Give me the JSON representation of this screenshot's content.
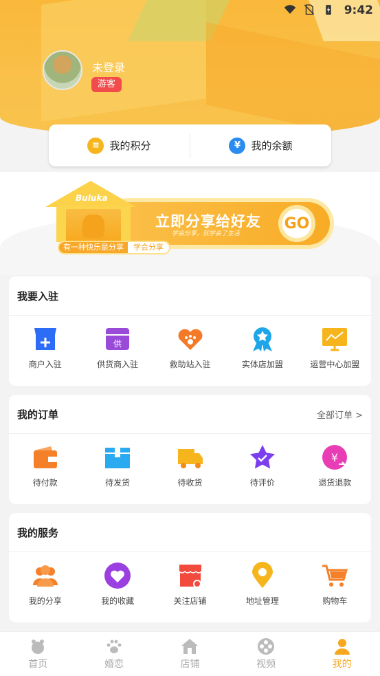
{
  "status_bar": {
    "time": "9:42"
  },
  "profile": {
    "username": "未登录",
    "role_badge": "游客"
  },
  "balance": {
    "points_label": "我的积分",
    "balance_label": "我的余额",
    "points_icon": "coins-icon",
    "balance_icon": "yen-icon"
  },
  "banner": {
    "brand": "Buluka",
    "title": "立即分享给好友",
    "subtitle": "学会分享，就学会了生活",
    "go_label": "GO",
    "tag_left": "有一种快乐是分享",
    "tag_right": "学会分享"
  },
  "settle_in": {
    "title": "我要入驻",
    "items": [
      {
        "label": "商户入驻",
        "icon": "store-add-icon",
        "color": "#2c6cf6"
      },
      {
        "label": "供货商入驻",
        "icon": "supplier-icon",
        "color": "#9a4ad9"
      },
      {
        "label": "救助站入驻",
        "icon": "paw-heart-icon",
        "color": "#f47a28"
      },
      {
        "label": "实体店加盟",
        "icon": "ribbon-star-icon",
        "color": "#1fa6e8"
      },
      {
        "label": "运营中心加盟",
        "icon": "monitor-chart-icon",
        "color": "#f7b51d"
      }
    ]
  },
  "orders": {
    "title": "我的订单",
    "more": "全部订单 >",
    "items": [
      {
        "label": "待付款",
        "icon": "wallet-icon",
        "color": "#f4812a"
      },
      {
        "label": "待发货",
        "icon": "box-icon",
        "color": "#2aaaf0"
      },
      {
        "label": "待收货",
        "icon": "truck-icon",
        "color": "#f7b51d"
      },
      {
        "label": "待评价",
        "icon": "star-check-icon",
        "color": "#7b3ff0"
      },
      {
        "label": "退货退款",
        "icon": "refund-icon",
        "color": "#e93db6"
      }
    ]
  },
  "services": {
    "title": "我的服务",
    "items": [
      {
        "label": "我的分享",
        "icon": "people-icon",
        "color": "#f4812a"
      },
      {
        "label": "我的收藏",
        "icon": "heart-icon",
        "color": "#9a3fe0"
      },
      {
        "label": "关注店铺",
        "icon": "shop-follow-icon",
        "color": "#f24a3d"
      },
      {
        "label": "地址管理",
        "icon": "location-pin-icon",
        "color": "#f7b51d"
      },
      {
        "label": "购物车",
        "icon": "cart-icon",
        "color": "#f4812a"
      }
    ]
  },
  "tabbar": {
    "items": [
      {
        "label": "首页",
        "icon": "home-pet-icon"
      },
      {
        "label": "婚恋",
        "icon": "paw-icon"
      },
      {
        "label": "店铺",
        "icon": "house-icon"
      },
      {
        "label": "视频",
        "icon": "film-reel-icon"
      },
      {
        "label": "我的",
        "icon": "person-icon"
      }
    ],
    "active_index": 4,
    "active_color": "#f7a71d"
  }
}
